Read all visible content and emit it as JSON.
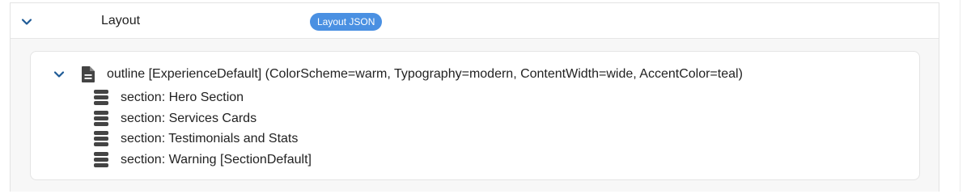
{
  "header": {
    "title": "Layout",
    "badge": "Layout JSON",
    "expand_icon": "chevron-down-icon"
  },
  "outline": {
    "label": "outline [ExperienceDefault] (ColorScheme=warm, Typography=modern, ContentWidth=wide, AccentColor=teal)",
    "expand_icon": "chevron-down-icon",
    "type_icon": "document-icon",
    "sections": [
      {
        "label": "section: Hero Section",
        "icon": "section-icon"
      },
      {
        "label": "section: Services Cards",
        "icon": "section-icon"
      },
      {
        "label": "section: Testimonials and Stats",
        "icon": "section-icon"
      },
      {
        "label": "section: Warning [SectionDefault]",
        "icon": "section-icon"
      }
    ]
  },
  "colors": {
    "badge_background": "#4a90e2",
    "chevron": "#1e5a96",
    "icon": "#444444",
    "panel_background": "#f7f7f7"
  }
}
